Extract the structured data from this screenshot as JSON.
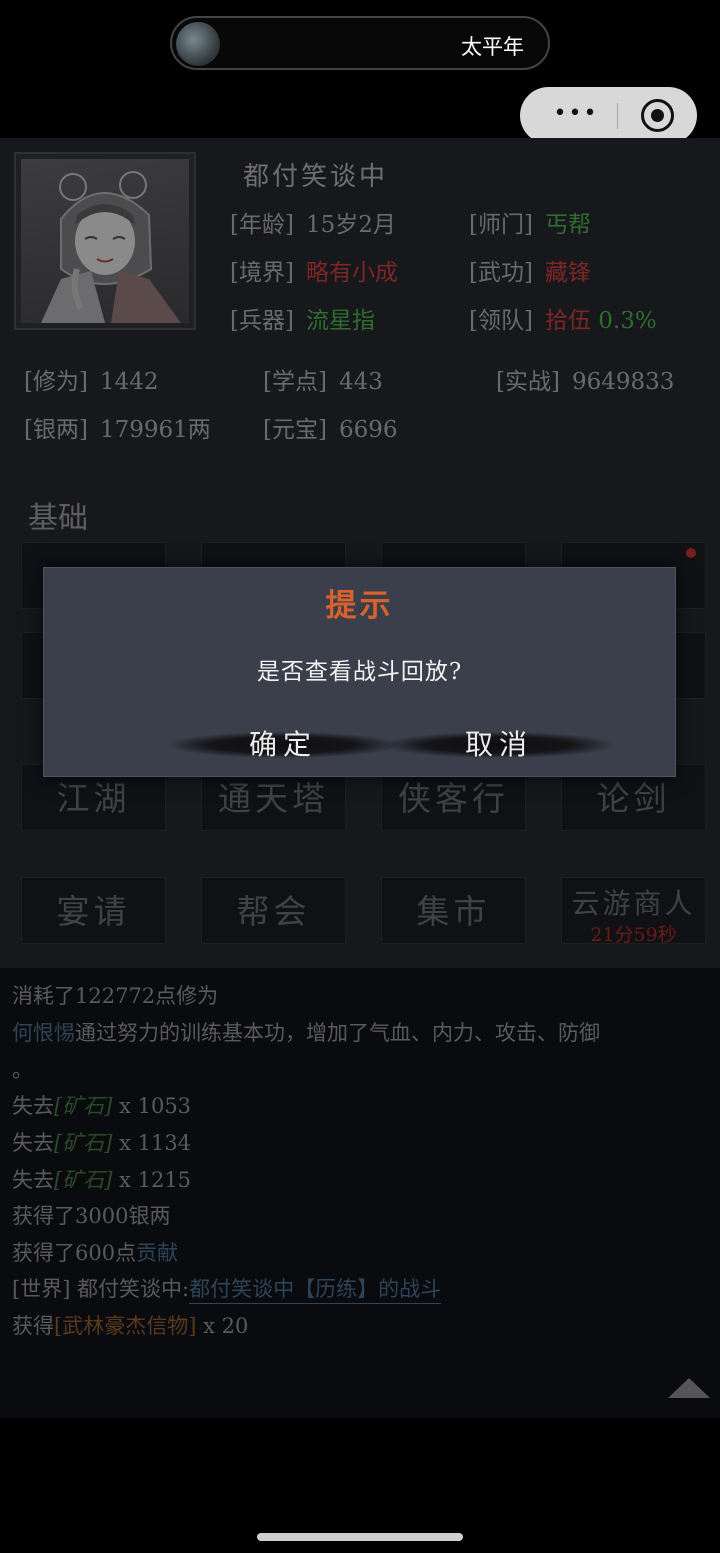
{
  "miniapp": {
    "title": "太平年",
    "more_icon": "more-dots-icon",
    "close_icon": "target-close-icon"
  },
  "profile": {
    "name": "都付笑谈中",
    "age_label": "[年龄]",
    "age_value": "15岁2月",
    "sect_label": "[师门]",
    "sect_value": "丐帮",
    "realm_label": "[境界]",
    "realm_value": "略有小成",
    "skill_label": "[武功]",
    "skill_value": "藏锋",
    "weapon_label": "[兵器]",
    "weapon_value": "流星指",
    "team_label": "[领队]",
    "team_value": "拾伍",
    "team_pct": "0.3%"
  },
  "stats": {
    "cultivation_label": "[修为]",
    "cultivation_value": "1442",
    "study_label": "[学点]",
    "study_value": "443",
    "combat_label": "[实战]",
    "combat_value": "9649833",
    "silver_label": "[银两]",
    "silver_value": "179961两",
    "ingot_label": "[元宝]",
    "ingot_value": "6696"
  },
  "section": {
    "basic": "基础"
  },
  "tiles": {
    "row3": [
      "江湖",
      "通天塔",
      "侠客行",
      "论剑"
    ],
    "row4": [
      "宴请",
      "帮会",
      "集市"
    ],
    "merchant_name": "云游商人",
    "merchant_timer": "21分59秒"
  },
  "log": {
    "l1": "消耗了122772点修为",
    "l2_name": "何恨惕",
    "l2_text": "通过努力的训练基本功，增加了气血、内力、攻击、防御",
    "l2_end": "。",
    "lose": "失去",
    "ore": "[矿石]",
    "ore_counts": [
      "x 1053",
      "x 1134",
      "x 1215"
    ],
    "silver_gain": "获得了3000银两",
    "contrib_pre": "获得了600点",
    "contrib_word": "贡献",
    "world_pre": "[世界] 都付笑谈中:",
    "world_link": "都付笑谈中【历练】的战斗",
    "gain_pre": "获得",
    "item": "[武林豪杰信物]",
    "item_count": "x 20"
  },
  "dialog": {
    "title": "提示",
    "message": "是否查看战斗回放?",
    "confirm": "确定",
    "cancel": "取消"
  }
}
